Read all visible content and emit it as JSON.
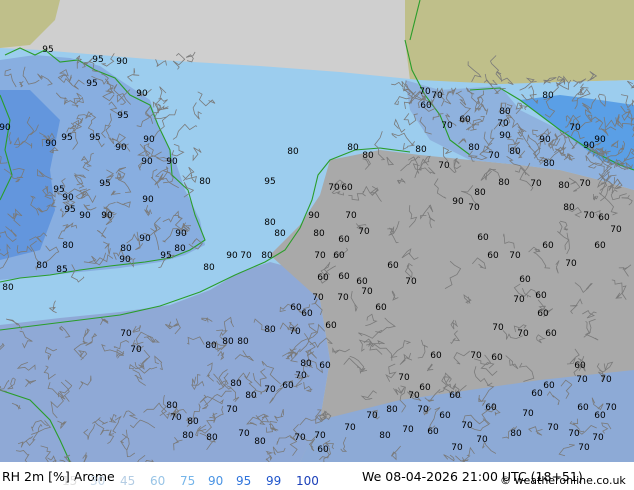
{
  "title": "RH 2m [%] Arome",
  "valid_time": "We 08-04-2026 21:00 UTC (18+51)",
  "credit": "© weatheronline.co.uk",
  "legend": [
    {
      "label": "15",
      "color": "#e0e0e0"
    },
    {
      "label": "30",
      "color": "#c8d8e8"
    },
    {
      "label": "45",
      "color": "#b4cde4"
    },
    {
      "label": "60",
      "color": "#98c4e6"
    },
    {
      "label": "75",
      "color": "#76b6ea"
    },
    {
      "label": "90",
      "color": "#4a94e4"
    },
    {
      "label": "95",
      "color": "#2f74dc"
    },
    {
      "label": "99",
      "color": "#1f55cc"
    },
    {
      "label": "100",
      "color": "#1a3fb8"
    }
  ],
  "colors": {
    "sea_high": "#9ccdee",
    "land_moist": "#88aee0",
    "land_dry": "#a9a9a9",
    "no_data": "#cfcfcf",
    "outside": "#bfbf8a",
    "coast": "#2a9d2a",
    "isoline": "#7a7a7a"
  },
  "isoline_labels": [
    "95",
    "95",
    "90",
    "95",
    "90",
    "95",
    "90",
    "90",
    "95",
    "95",
    "90",
    "90",
    "90",
    "90",
    "95",
    "95",
    "90",
    "90",
    "95",
    "90",
    "90",
    "80",
    "80",
    "90",
    "80",
    "90",
    "95",
    "90",
    "80",
    "85",
    "80",
    "80",
    "80",
    "95",
    "80",
    "90",
    "80",
    "70",
    "80",
    "80",
    "90",
    "80",
    "80",
    "80",
    "70",
    "60",
    "70",
    "60",
    "70",
    "60",
    "70",
    "60",
    "60",
    "60",
    "70",
    "70",
    "70",
    "60",
    "60",
    "60",
    "60",
    "60",
    "70",
    "70",
    "70",
    "60",
    "60",
    "70",
    "80",
    "70",
    "80",
    "70",
    "80",
    "80",
    "70",
    "90",
    "90",
    "80",
    "90",
    "90",
    "80",
    "70",
    "80",
    "90",
    "70",
    "80",
    "70",
    "80",
    "70",
    "80",
    "70",
    "60",
    "70",
    "60",
    "60",
    "60",
    "70",
    "60",
    "70",
    "60",
    "60",
    "70",
    "60",
    "60",
    "70",
    "70",
    "60",
    "70",
    "60",
    "60",
    "70",
    "70",
    "60",
    "60",
    "60",
    "60",
    "70",
    "60",
    "60",
    "60",
    "70",
    "70",
    "70",
    "60",
    "60",
    "70",
    "70",
    "70",
    "80",
    "70",
    "70",
    "70",
    "70",
    "70",
    "70",
    "70",
    "80",
    "80",
    "80",
    "80",
    "70",
    "80",
    "60",
    "70",
    "60",
    "70",
    "80",
    "80",
    "70",
    "80",
    "70",
    "80",
    "80",
    "80",
    "70",
    "80",
    "70",
    "70",
    "70",
    "80",
    "70",
    "80",
    "70",
    "60",
    "70",
    "60",
    "60",
    "70"
  ]
}
